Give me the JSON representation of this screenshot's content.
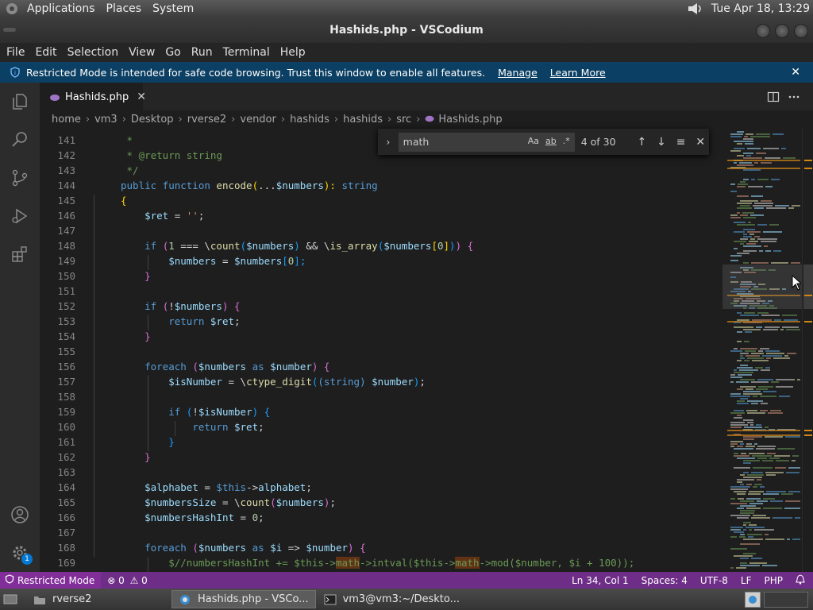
{
  "top_panel": {
    "menus": [
      "Applications",
      "Places",
      "System"
    ],
    "clock": "Tue Apr 18, 13:29"
  },
  "window": {
    "title": "Hashids.php - VSCodium"
  },
  "menubar": [
    "File",
    "Edit",
    "Selection",
    "View",
    "Go",
    "Run",
    "Terminal",
    "Help"
  ],
  "banner": {
    "text": "Restricted Mode is intended for safe code browsing. Trust this window to enable all features.",
    "manage": "Manage",
    "learn_more": "Learn More"
  },
  "tab": {
    "label": "Hashids.php"
  },
  "breadcrumbs": [
    "home",
    "vm3",
    "Desktop",
    "rverse2",
    "vendor",
    "hashids",
    "hashids",
    "src",
    "Hashids.php"
  ],
  "find": {
    "query": "math",
    "opt_case": "Aa",
    "opt_word": "ab",
    "opt_regex": ".*",
    "count": "4 of 30"
  },
  "line_numbers": [
    "141",
    "142",
    "143",
    "144",
    "145",
    "146",
    "147",
    "148",
    "149",
    "150",
    "151",
    "152",
    "153",
    "154",
    "155",
    "156",
    "157",
    "158",
    "159",
    "160",
    "161",
    "162",
    "163",
    "164",
    "165",
    "166",
    "167",
    "168",
    "169"
  ],
  "statusbar": {
    "restricted": "Restricted Mode",
    "errors": "0",
    "warnings": "0",
    "position": "Ln 34, Col 1",
    "spaces": "Spaces: 4",
    "encoding": "UTF-8",
    "eol": "LF",
    "language": "PHP"
  },
  "taskbar": {
    "items": [
      "rverse2",
      "Hashids.php - VSCo...",
      "vm3@vm3:~/Deskto..."
    ]
  },
  "colors": {
    "statusbar": "#6e2d86",
    "banner": "#0b3f63",
    "find_highlight": "#613214",
    "activity_badge": "#0078d4"
  },
  "badges": {
    "settings": "1"
  }
}
